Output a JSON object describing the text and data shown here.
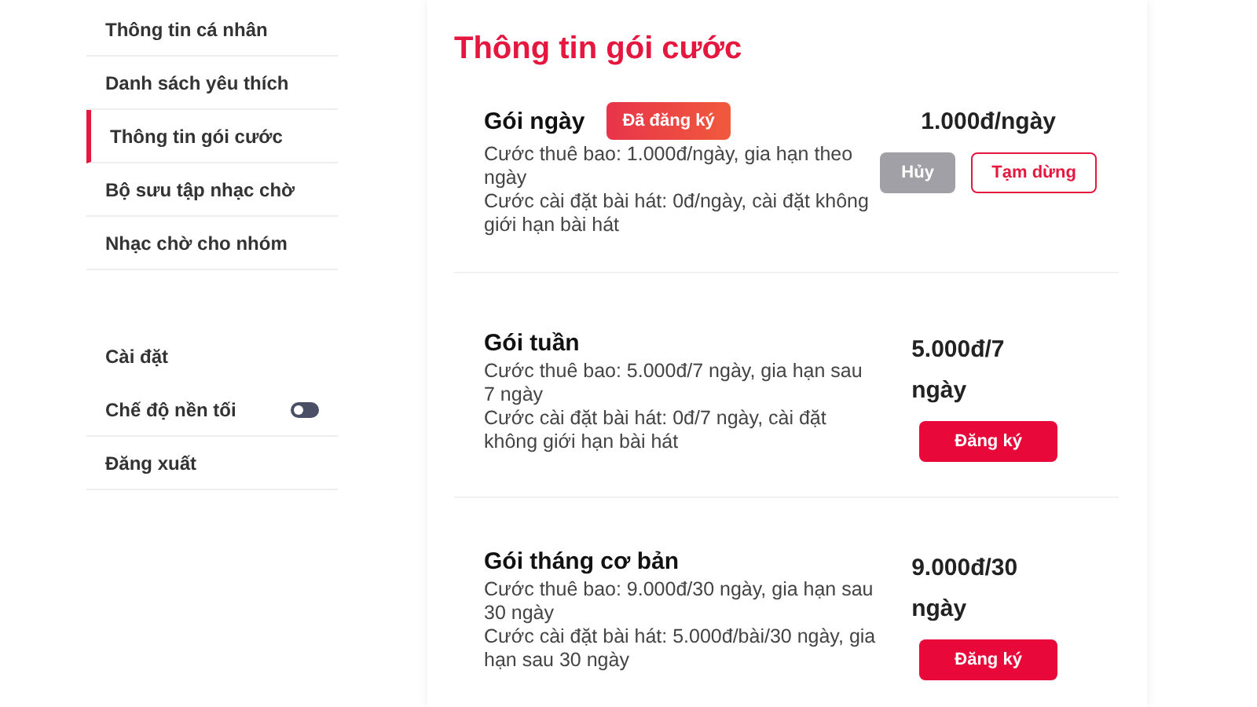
{
  "sidebar": {
    "menu": [
      {
        "label": "Thông tin cá nhân",
        "selected": false
      },
      {
        "label": "Danh sách yêu thích",
        "selected": false
      },
      {
        "label": "Thông tin gói cước",
        "selected": true
      },
      {
        "label": "Bộ sưu tập nhạc chờ",
        "selected": false
      },
      {
        "label": "Nhạc chờ cho nhóm",
        "selected": false
      }
    ],
    "settings": [
      {
        "kind": "link",
        "label": "Cài đặt"
      },
      {
        "kind": "toggle",
        "label": "Chế độ nền tối",
        "on": false
      },
      {
        "kind": "link",
        "label": "Đăng xuất"
      }
    ]
  },
  "main": {
    "title": "Thông tin gói cước",
    "packages": [
      {
        "name": "Gói ngày",
        "badge": "Đã đăng ký",
        "description": [
          "Cước thuê bao: 1.000đ/ngày, gia hạn theo ngày",
          "Cước cài đặt bài hát: 0đ/ngày, cài đặt không giới hạn bài hát"
        ],
        "price": "1.000đ/ngày",
        "buttons": [
          {
            "kind": "cancel",
            "label": "Hủy"
          },
          {
            "kind": "pause",
            "label": "Tạm dừng"
          }
        ]
      },
      {
        "name": "Gói tuần",
        "description": [
          "Cước thuê bao: 5.000đ/7 ngày, gia hạn sau 7 ngày",
          "Cước cài đặt bài hát: 0đ/7 ngày, cài đặt không giới hạn bài hát"
        ],
        "price": "5.000đ/7 ngày",
        "buttons": [
          {
            "kind": "register",
            "label": "Đăng ký"
          }
        ]
      },
      {
        "name": "Gói tháng cơ bản",
        "description": [
          "Cước thuê bao: 9.000đ/30 ngày, gia hạn sau 30 ngày",
          "Cước cài đặt bài hát: 5.000đ/bài/30 ngày, gia hạn sau 30 ngày"
        ],
        "price": "9.000đ/30 ngày",
        "buttons": [
          {
            "kind": "register",
            "label": "Đăng ký"
          }
        ]
      }
    ]
  }
}
